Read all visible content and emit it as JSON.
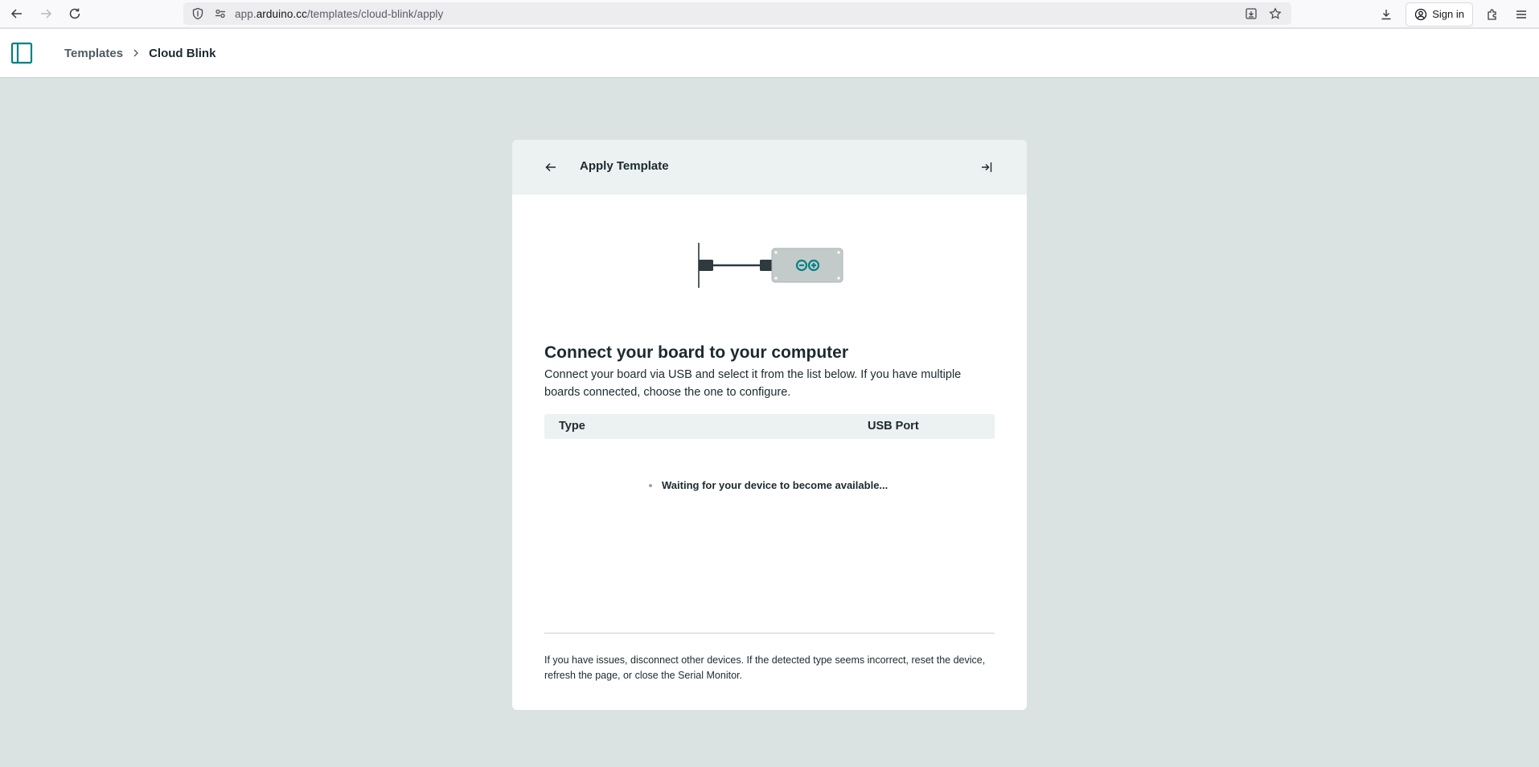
{
  "browser": {
    "url_prefix": "app.",
    "url_host": "arduino.cc",
    "url_path": "/templates/cloud-blink/apply",
    "signin_label": "Sign in"
  },
  "header": {
    "breadcrumb": {
      "parent": "Templates",
      "current": "Cloud Blink"
    }
  },
  "card": {
    "title": "Apply Template",
    "heading": "Connect your board to your computer",
    "description": "Connect your board via USB and select it from the list below. If you have multiple boards connected, choose the one to configure.",
    "table": {
      "columns": [
        "Type",
        "USB Port"
      ]
    },
    "waiting_text": "Waiting for your device to become available...",
    "footer_note": "If you have issues, disconnect other devices. If the detected type seems incorrect, reset the device, refresh the page, or close the Serial Monitor."
  },
  "colors": {
    "brand_teal": "#008184",
    "page_bg": "#dae3e2",
    "card_header_bg": "#ecf1f1"
  },
  "icons": {
    "back": "arrow-left-icon",
    "forward": "arrow-right-icon",
    "reload": "reload-icon",
    "shield": "shield-icon",
    "permissions": "permissions-icon",
    "page_save": "save-to-pocket-icon",
    "bookmark": "star-icon",
    "downloads": "download-icon",
    "account": "account-icon",
    "extensions": "puzzle-icon",
    "menu": "hamburger-menu-icon",
    "sidebar": "sidebar-toggle-icon",
    "chevron": "chevron-right-icon",
    "exit": "exit-icon",
    "board": "arduino-board-illustration"
  }
}
